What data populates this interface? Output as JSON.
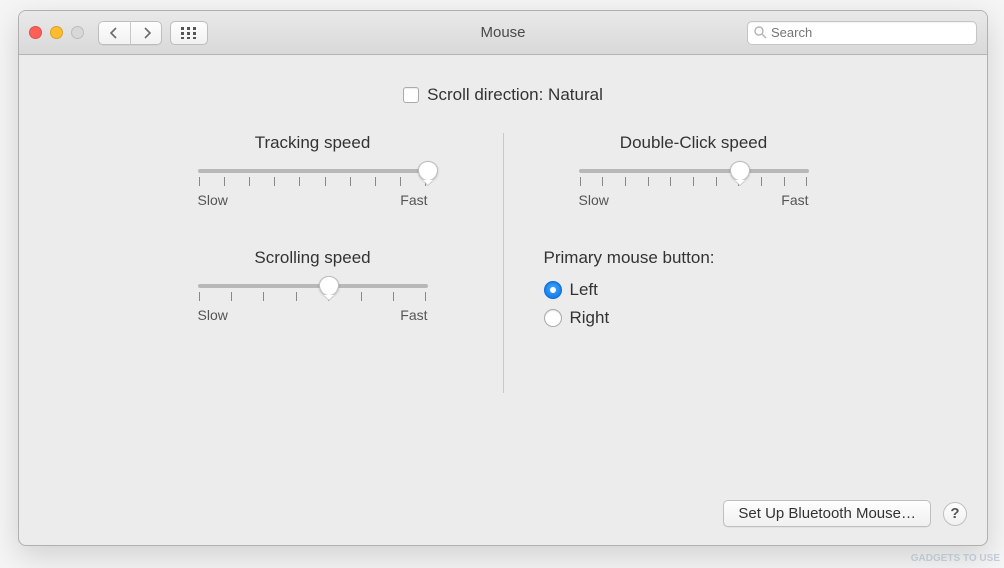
{
  "window": {
    "title": "Mouse"
  },
  "search": {
    "placeholder": "Search"
  },
  "scroll_direction": {
    "label": "Scroll direction: Natural",
    "checked": false
  },
  "sliders": {
    "tracking": {
      "title": "Tracking speed",
      "min_label": "Slow",
      "max_label": "Fast",
      "ticks": 10,
      "value": 9,
      "max": 9
    },
    "scrolling": {
      "title": "Scrolling speed",
      "min_label": "Slow",
      "max_label": "Fast",
      "ticks": 8,
      "value": 4,
      "max": 7
    },
    "double_click": {
      "title": "Double-Click speed",
      "min_label": "Slow",
      "max_label": "Fast",
      "ticks": 11,
      "value": 7,
      "max": 10
    }
  },
  "primary_button": {
    "title": "Primary mouse button:",
    "options": {
      "left": "Left",
      "right": "Right"
    },
    "selected": "left"
  },
  "footer": {
    "setup_bt": "Set Up Bluetooth Mouse…",
    "help": "?"
  },
  "watermark": "GADGETS TO USE"
}
